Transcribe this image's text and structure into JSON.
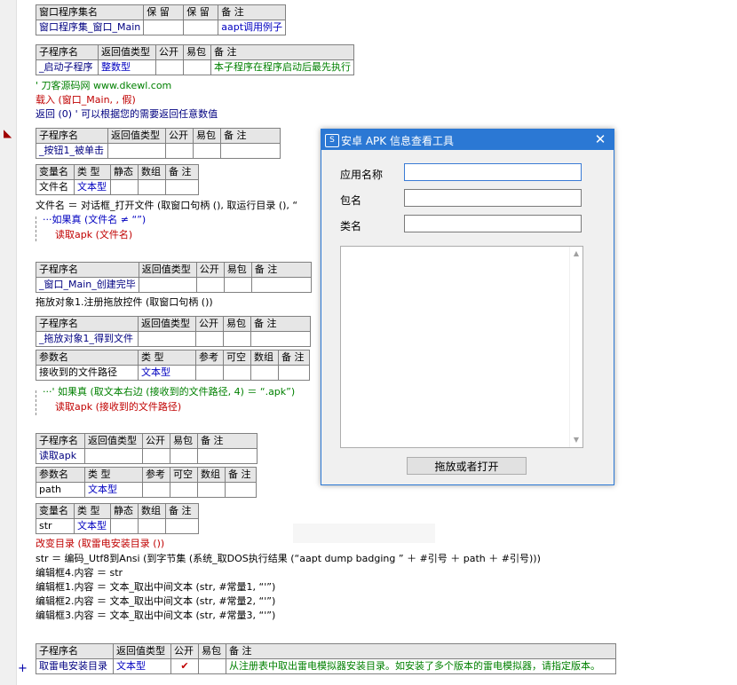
{
  "window_table": {
    "headers": [
      "窗口程序集名",
      "保 留",
      "保 留",
      "备 注"
    ],
    "row": [
      "窗口程序集_窗口_Main",
      "",
      "",
      "aapt调用例子"
    ]
  },
  "sub1": {
    "headers": [
      "子程序名",
      "返回值类型",
      "公开",
      "易包",
      "备 注"
    ],
    "row": [
      "_启动子程序",
      "整数型",
      "",
      "",
      "本子程序在程序启动后最先执行"
    ]
  },
  "code1": {
    "comment_site": "' 刀客源码网 www.dkewl.com",
    "load": "载入 (窗口_Main, , 假)",
    "ret": "返回 (0)  ' 可以根据您的需要返回任意数值"
  },
  "sub2": {
    "headers": [
      "子程序名",
      "返回值类型",
      "公开",
      "易包",
      "备 注"
    ],
    "row": [
      "_按钮1_被单击",
      "",
      "",
      "",
      ""
    ]
  },
  "var2": {
    "headers": [
      "变量名",
      "类 型",
      "静态",
      "数组",
      "备 注"
    ],
    "row": [
      "文件名",
      "文本型",
      "",
      "",
      ""
    ]
  },
  "code2": {
    "line1": "文件名 ＝ 对话框_打开文件 (取窗口句柄 (), 取运行目录 (), “",
    "line2": "如果真 (文件名 ≠ “”)",
    "line3": "读取apk (文件名)"
  },
  "sub3": {
    "headers": [
      "子程序名",
      "返回值类型",
      "公开",
      "易包",
      "备 注"
    ],
    "row": [
      "_窗口_Main_创建完毕",
      "",
      "",
      "",
      ""
    ]
  },
  "code3": {
    "line1": "拖放对象1.注册拖放控件 (取窗口句柄 ())"
  },
  "sub4": {
    "headers": [
      "子程序名",
      "返回值类型",
      "公开",
      "易包",
      "备 注"
    ],
    "row": [
      "_拖放对象1_得到文件",
      "",
      "",
      "",
      ""
    ]
  },
  "param4": {
    "headers": [
      "参数名",
      "类 型",
      "参考",
      "可空",
      "数组",
      "备 注"
    ],
    "row": [
      "接收到的文件路径",
      "文本型",
      "",
      "",
      "",
      ""
    ]
  },
  "code4": {
    "line1": "' 如果真 (取文本右边 (接收到的文件路径, 4) ＝ “.apk”)",
    "line2": "读取apk (接收到的文件路径)"
  },
  "sub5": {
    "headers": [
      "子程序名",
      "返回值类型",
      "公开",
      "易包",
      "备 注"
    ],
    "row": [
      "读取apk",
      "",
      "",
      "",
      ""
    ]
  },
  "param5": {
    "headers": [
      "参数名",
      "类 型",
      "参考",
      "可空",
      "数组",
      "备 注"
    ],
    "row": [
      "path",
      "文本型",
      "",
      "",
      "",
      ""
    ]
  },
  "var5": {
    "headers": [
      "变量名",
      "类 型",
      "静态",
      "数组",
      "备 注"
    ],
    "row": [
      "str",
      "文本型",
      "",
      "",
      ""
    ]
  },
  "code5": {
    "line1": "改变目录 (取雷电安装目录 ())",
    "line2": "str ＝ 编码_Utf8到Ansi (到字节集 (系统_取DOS执行结果 (“aapt dump badging ” ＋ #引号 ＋ path ＋ #引号)))",
    "line3": "编辑框4.内容 ＝ str",
    "line4": "编辑框1.内容 ＝ 文本_取出中间文本 (str, #常量1, “'”)",
    "line5": "编辑框2.内容 ＝ 文本_取出中间文本 (str, #常量2, “'”)",
    "line6": "编辑框3.内容 ＝ 文本_取出中间文本 (str, #常量3, “'”)"
  },
  "sub6": {
    "headers": [
      "子程序名",
      "返回值类型",
      "公开",
      "易包",
      "备 注"
    ],
    "row": [
      "取雷电安装目录",
      "文本型",
      "✔",
      "",
      "从注册表中取出雷电模拟器安装目录。如安装了多个版本的雷电模拟器，请指定版本。"
    ]
  },
  "gutter": {
    "plus": "+"
  },
  "dialog": {
    "title": "安卓 APK 信息查看工具",
    "close": "✕",
    "label_app": "应用名称",
    "label_pkg": "包名",
    "label_cls": "类名",
    "button": "拖放或者打开"
  }
}
